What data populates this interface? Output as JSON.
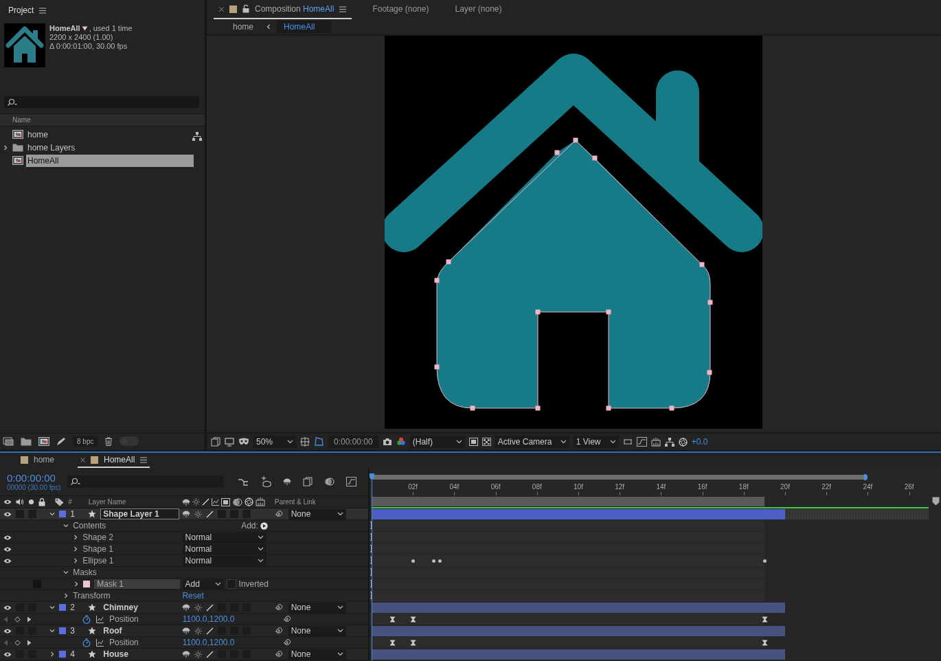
{
  "project": {
    "title": "Project",
    "preview": {
      "name": "HomeAll",
      "usage": ", used 1 time",
      "size": "2200 x 2400 (1.00)",
      "duration": "Δ 0:00:01:00, 30.00 fps"
    },
    "columns": [
      "Name"
    ],
    "items": [
      {
        "name": "home",
        "kind": "composition",
        "selected": false
      },
      {
        "name": "home Layers",
        "kind": "folder",
        "selected": false
      },
      {
        "name": "HomeAll",
        "kind": "composition",
        "selected": true
      }
    ],
    "bit_depth": "8 bpc",
    "toggle": {
      "on": false
    }
  },
  "viewer": {
    "tabs": [
      {
        "label": "Composition",
        "name": "HomeAll",
        "selected": true
      },
      {
        "label": "Footage (none)",
        "selected": false
      },
      {
        "label": "Layer (none)",
        "selected": false
      }
    ],
    "breadcrumbs": [
      {
        "label": "home",
        "selected": false
      },
      {
        "label": "HomeAll",
        "selected": true
      }
    ],
    "toolbar": {
      "zoom": "50%",
      "timecode": "0:00:00:00",
      "resolution": "(Half)",
      "camera": "Active Camera",
      "views": "1 View",
      "exposure": "+0.0"
    }
  },
  "timeline": {
    "tabs": [
      {
        "label": "home",
        "selected": false
      },
      {
        "label": "HomeAll",
        "selected": true
      }
    ],
    "timecode": "0:00:00:00",
    "frames": "00000 (30.00 fps)",
    "columns": [
      "#",
      "Layer Name",
      "Parent & Link"
    ],
    "ruler": [
      "02f",
      "04f",
      "06f",
      "08f",
      "10f",
      "12f",
      "14f",
      "16f",
      "18f",
      "20f",
      "22f",
      "24f",
      "26f"
    ],
    "rows": [
      {
        "kind": "layer",
        "number": "1",
        "name": "Shape Layer 1",
        "color": "#5b6ee0",
        "expanded": true,
        "selected": true,
        "visible": true,
        "parent": "None"
      },
      {
        "kind": "group",
        "name": "Contents",
        "expanded": true,
        "action": "Add:"
      },
      {
        "kind": "content",
        "name": "Shape 2",
        "expanded": false,
        "visible": true,
        "mode": "Normal"
      },
      {
        "kind": "content",
        "name": "Shape 1",
        "expanded": false,
        "visible": true,
        "mode": "Normal"
      },
      {
        "kind": "content",
        "name": "Ellipse 1",
        "expanded": false,
        "visible": true,
        "mode": "Normal"
      },
      {
        "kind": "group",
        "name": "Masks",
        "expanded": true
      },
      {
        "kind": "mask",
        "name": "Mask 1",
        "color": "#f0c4d0",
        "expanded": false,
        "locked": false,
        "mode": "Add",
        "inverted": false,
        "option": "Inverted"
      },
      {
        "kind": "group",
        "name": "Transform",
        "expanded": false,
        "link": "Reset"
      },
      {
        "kind": "layer",
        "number": "2",
        "name": "Chimney",
        "color": "#5b6ee0",
        "expanded": true,
        "selected": false,
        "visible": true,
        "parent": "None"
      },
      {
        "kind": "property",
        "name": "Position",
        "value": "1100.0,1200.0"
      },
      {
        "kind": "layer",
        "number": "3",
        "name": "Roof",
        "color": "#5b6ee0",
        "expanded": true,
        "selected": false,
        "visible": true,
        "parent": "None"
      },
      {
        "kind": "property",
        "name": "Position",
        "value": "1100.0,1200.0"
      },
      {
        "kind": "layer",
        "number": "4",
        "name": "House",
        "color": "#5b6ee0",
        "expanded": false,
        "selected": false,
        "visible": true,
        "parent": "None"
      }
    ]
  }
}
